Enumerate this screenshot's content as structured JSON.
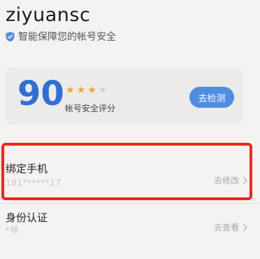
{
  "account": {
    "username": "ziyuansc",
    "subtitle": "智能保障您的帐号安全"
  },
  "score_card": {
    "score": "90",
    "stars_filled": 3,
    "stars_total": 4,
    "label": "帐号安全评分",
    "check_button": "去检测"
  },
  "rows": [
    {
      "title": "绑定手机",
      "value": "181******17",
      "action": "去修改"
    },
    {
      "title": "身份认证",
      "value": "*琴",
      "action": "去查看"
    }
  ],
  "colors": {
    "accent": "#2f6fd8",
    "button": "#4d8ee2",
    "star": "#f0a72a",
    "highlight": "#f32418"
  },
  "icons": {
    "subtitle_icon": "shield-check-icon",
    "row_chevron": "chevron-right-icon"
  }
}
